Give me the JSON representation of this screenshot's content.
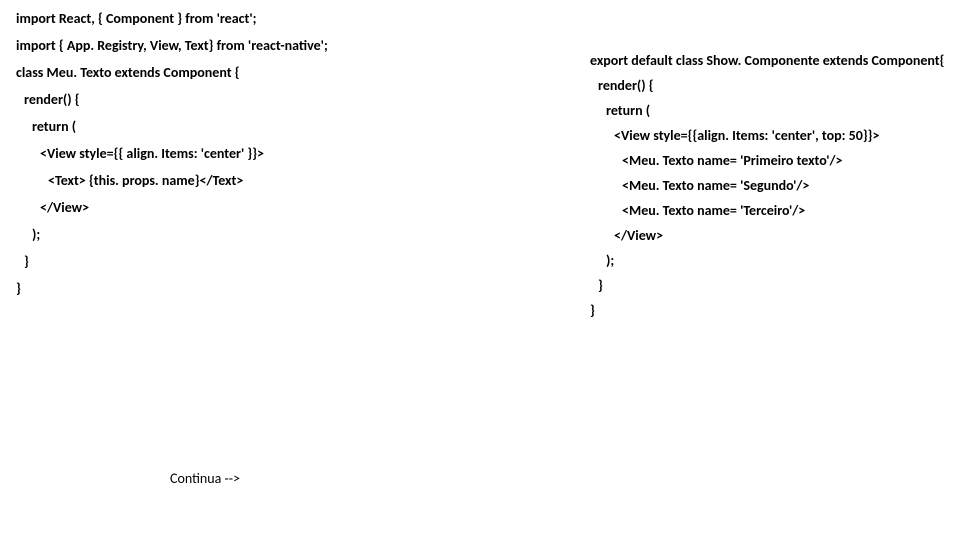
{
  "left": {
    "l1": "import React, { Component } from 'react';",
    "l2": "import { App. Registry, View, Text} from 'react-native';",
    "l3": "class Meu. Texto extends Component {",
    "l4": "render() {",
    "l5": "return (",
    "l6": "<View style={{ align. Items: 'center' }}>",
    "l7": "<Text> {this. props. name}</Text>",
    "l8": "</View>",
    "l9": ");",
    "l10": "}",
    "l11": "}"
  },
  "right": {
    "r1": "export default class Show. Componente extends Component{",
    "r2": "render() {",
    "r3": "return (",
    "r4": "<View style={{align. Items: 'center', top: 50}}>",
    "r5": "<Meu. Texto name= 'Primeiro texto'/>",
    "r6": "<Meu. Texto name= 'Segundo'/>",
    "r7": "<Meu. Texto name= 'Terceiro'/>",
    "r8": "</View>",
    "r9": ");",
    "r10": "}",
    "r11": "}"
  },
  "footer": {
    "continua": "Continua -->"
  }
}
